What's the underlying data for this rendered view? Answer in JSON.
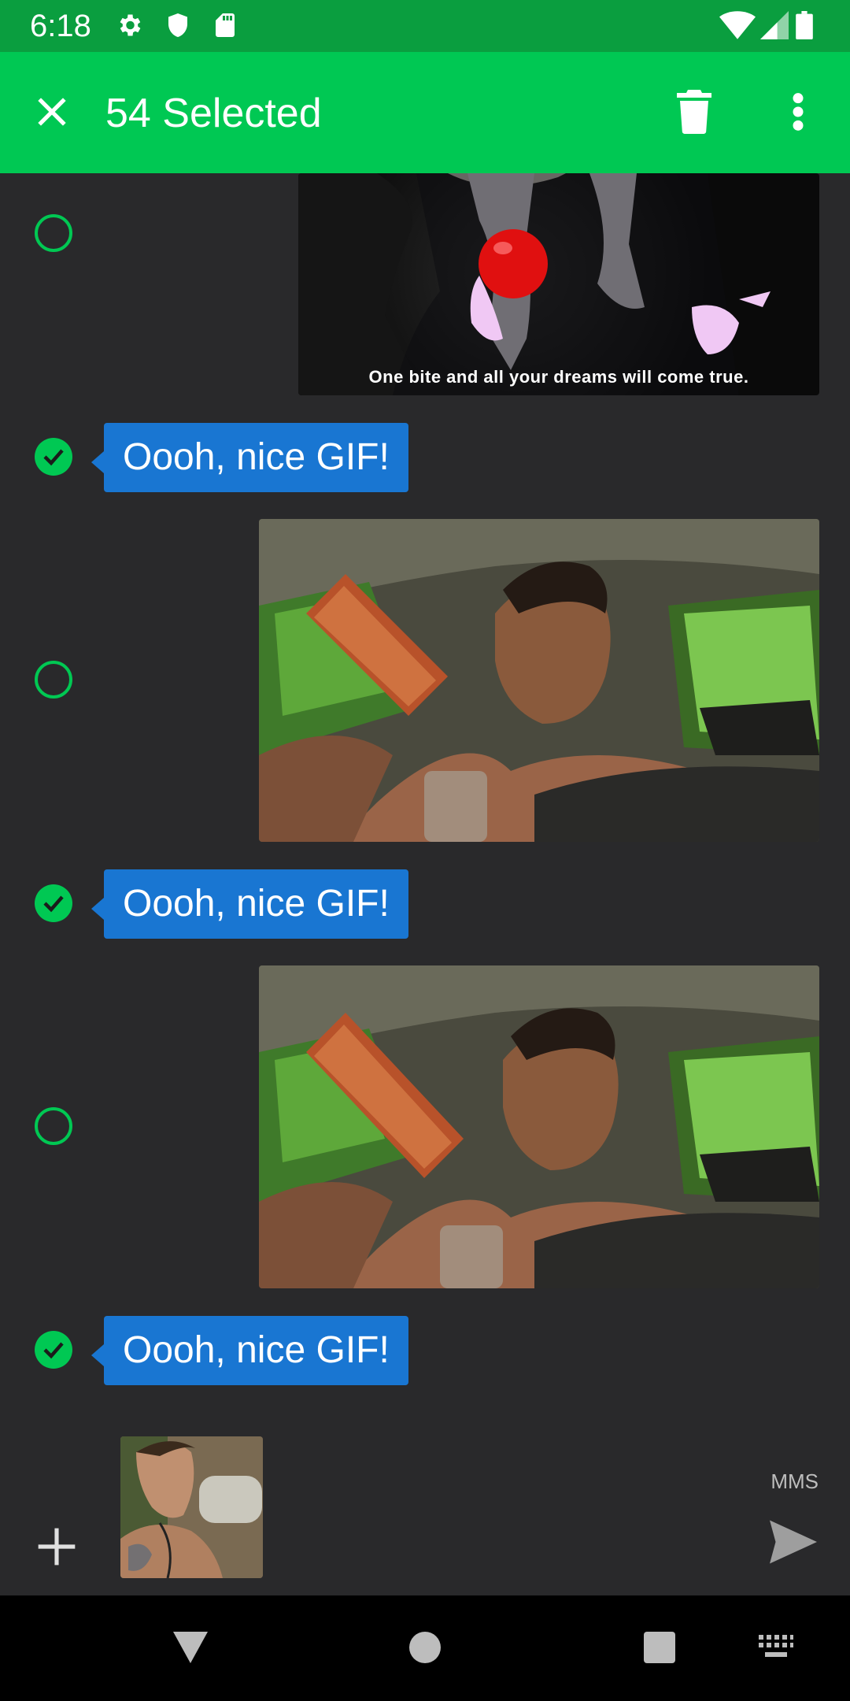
{
  "status_bar": {
    "time": "6:18",
    "left_icons": [
      "gear-icon",
      "shield-icon",
      "sd-card-icon"
    ],
    "right_icons": [
      "wifi-icon",
      "signal-icon",
      "battery-icon"
    ]
  },
  "app_bar": {
    "title": "54 Selected",
    "actions": [
      "close-icon",
      "delete-icon",
      "more-vert-icon"
    ],
    "color": "#00c853"
  },
  "messages": [
    {
      "type": "gif",
      "selected": false,
      "caption": "One bite and all your dreams will come true."
    },
    {
      "type": "text",
      "selected": true,
      "text": "Oooh, nice GIF!"
    },
    {
      "type": "gif",
      "selected": false
    },
    {
      "type": "text",
      "selected": true,
      "text": "Oooh, nice GIF!"
    },
    {
      "type": "gif",
      "selected": false
    },
    {
      "type": "text",
      "selected": true,
      "text": "Oooh, nice GIF!"
    }
  ],
  "compose": {
    "mode_label": "MMS",
    "attachment": "image-attachment",
    "add_icon": "plus-icon",
    "send_icon": "send-icon"
  },
  "nav_bar": {
    "buttons": [
      "back-icon",
      "home-icon",
      "recents-icon",
      "keyboard-icon"
    ]
  },
  "colors": {
    "accent": "#00c853",
    "status_bar": "#0a9e3f",
    "bubble": "#1976d2",
    "background": "#29292b"
  }
}
